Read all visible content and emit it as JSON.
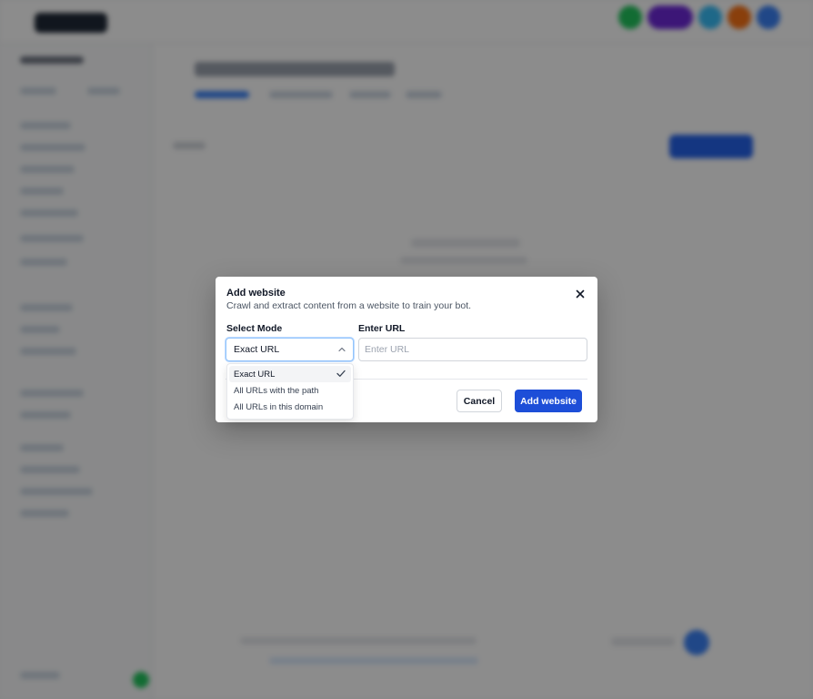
{
  "modal": {
    "title": "Add website",
    "subtitle": "Crawl and extract content from a website to train your bot.",
    "mode_label": "Select Mode",
    "mode_value": "Exact URL",
    "url_label": "Enter URL",
    "url_placeholder": "Enter URL",
    "url_value": "",
    "cancel_label": "Cancel",
    "add_label": "Add website",
    "close_icon": "close-icon",
    "chevron_icon": "chevron-up-icon"
  },
  "dropdown": {
    "options": [
      "Exact URL",
      "All URLs with the path",
      "All URLs in this domain"
    ],
    "selected": "Exact URL",
    "check_icon": "checkmark-icon"
  },
  "colors": {
    "primary": "#1d4ed8",
    "overlay": "rgba(0,0,0,0.45)",
    "focus_border": "#93c5fd"
  }
}
